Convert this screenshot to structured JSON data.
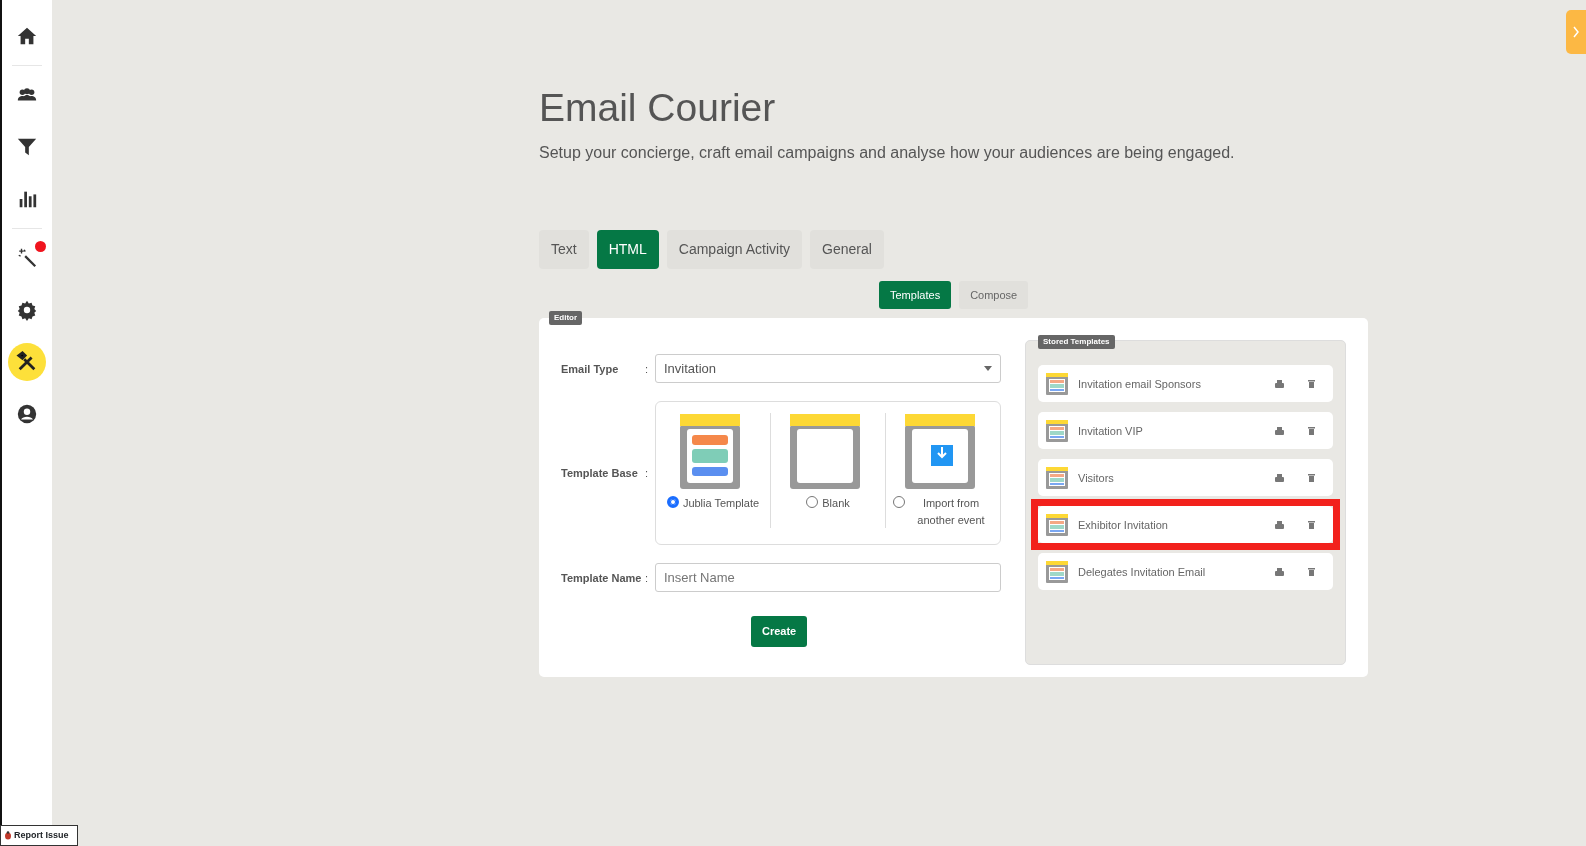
{
  "sidebar": {
    "items": [
      {
        "kind": "home",
        "selected": false,
        "notification": false
      },
      {
        "kind": "people",
        "selected": false,
        "notification": false
      },
      {
        "kind": "filter",
        "selected": false,
        "notification": false
      },
      {
        "kind": "chart",
        "selected": false,
        "notification": false
      },
      {
        "kind": "wand",
        "selected": false,
        "notification": true
      },
      {
        "kind": "gear",
        "selected": false,
        "notification": false
      },
      {
        "kind": "tools",
        "selected": true,
        "notification": false
      },
      {
        "kind": "user",
        "selected": false,
        "notification": false
      }
    ]
  },
  "header": {
    "title": "Email Courier",
    "subtitle": "Setup your concierge, craft email campaigns and analyse how your audiences are being engaged."
  },
  "tabs": [
    {
      "label": "Text",
      "selected": false
    },
    {
      "label": "HTML",
      "selected": true
    },
    {
      "label": "Campaign Activity",
      "selected": false
    },
    {
      "label": "General",
      "selected": false
    }
  ],
  "subtabs": [
    {
      "label": "Templates",
      "selected": true
    },
    {
      "label": "Compose",
      "selected": false
    }
  ],
  "editor": {
    "legend": "Editor",
    "email_type": {
      "label": "Email Type",
      "separator": ":",
      "value": "Invitation"
    },
    "template_base": {
      "label": "Template Base",
      "separator": ":",
      "options": [
        {
          "kind": "jublia",
          "label": "Jublia Template",
          "selected": true
        },
        {
          "kind": "blank",
          "label": "Blank",
          "selected": false
        },
        {
          "kind": "import",
          "label": "Import from another event",
          "selected": false
        }
      ]
    },
    "template_name": {
      "label": "Template Name",
      "separator": ":",
      "placeholder": "Insert Name"
    },
    "create_button": "Create"
  },
  "stored_templates": {
    "legend": "Stored Templates",
    "items": [
      {
        "name": "Invitation email Sponsors",
        "highlighted": false
      },
      {
        "name": "Invitation VIP",
        "highlighted": false
      },
      {
        "name": "Visitors",
        "highlighted": false
      },
      {
        "name": "Exhibitor Invitation",
        "highlighted": true
      },
      {
        "name": "Delegates Invitation Email",
        "highlighted": false
      }
    ]
  },
  "report_issue": "Report Issue"
}
